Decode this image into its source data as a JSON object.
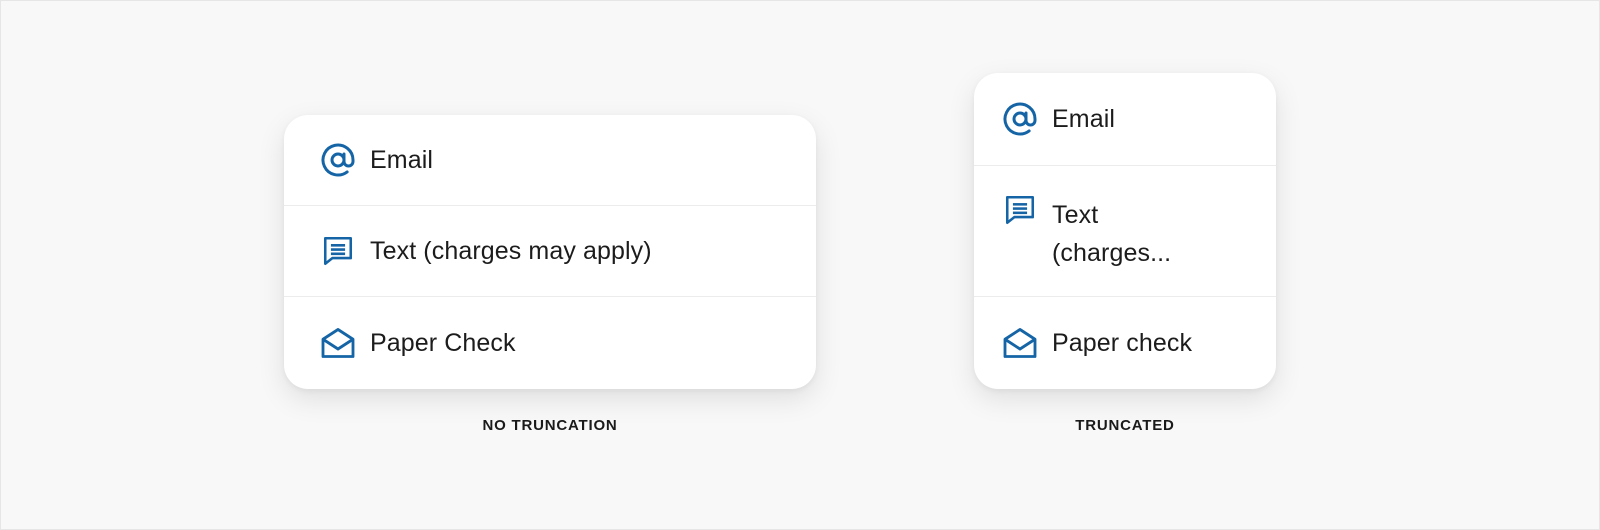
{
  "accent_color": "#1565a6",
  "left_card": {
    "items": [
      {
        "icon": "at-sign-icon",
        "label": "Email"
      },
      {
        "icon": "message-icon",
        "label": "Text (charges may apply)"
      },
      {
        "icon": "open-envelope-icon",
        "label": "Paper Check"
      }
    ],
    "caption": "NO TRUNCATION"
  },
  "right_card": {
    "items": [
      {
        "icon": "at-sign-icon",
        "label": "Email"
      },
      {
        "icon": "message-icon",
        "label": "Text (charges..."
      },
      {
        "icon": "open-envelope-icon",
        "label": "Paper check"
      }
    ],
    "caption": "TRUNCATED"
  }
}
